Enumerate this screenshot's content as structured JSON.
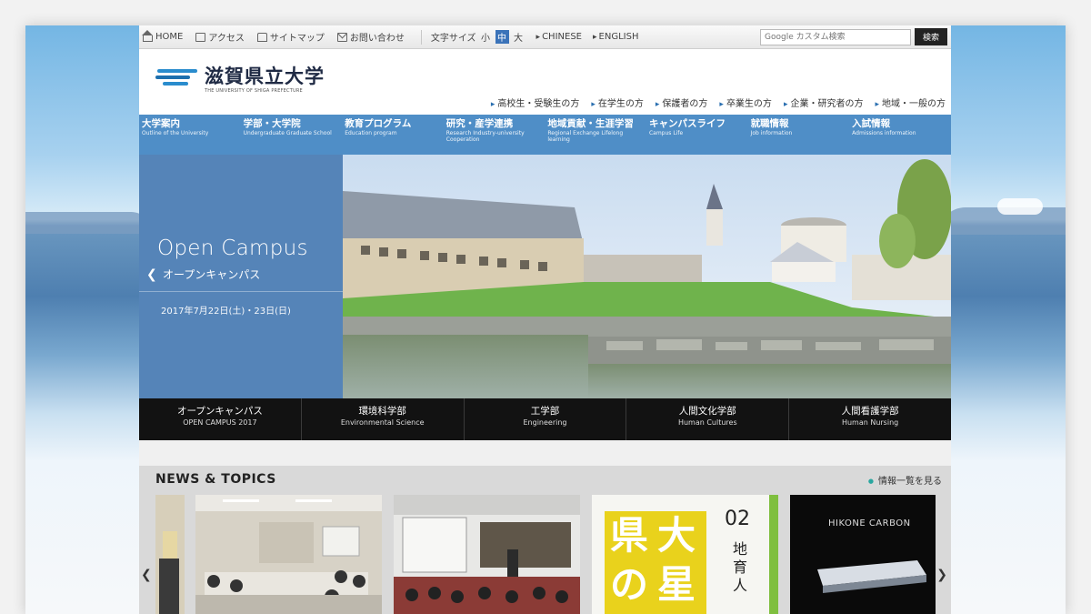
{
  "utility_bar": {
    "links": [
      {
        "label": "HOME",
        "icon": "home-icon"
      },
      {
        "label": "アクセス",
        "icon": "access-icon"
      },
      {
        "label": "サイトマップ",
        "icon": "sitemap-icon"
      },
      {
        "label": "お問い合わせ",
        "icon": "mail-icon"
      }
    ],
    "font_size_label": "文字サイズ",
    "font_sizes": [
      "小",
      "中",
      "大"
    ],
    "font_size_selected": "中",
    "languages": [
      "CHINESE",
      "ENGLISH"
    ],
    "search_placeholder": "Google カスタム検索",
    "search_button": "検索"
  },
  "header": {
    "logo_ja": "滋賀県立大学",
    "logo_en": "THE UNIVERSITY OF SHIGA PREFECTURE",
    "audience_links": [
      "高校生・受験生の方",
      "在学生の方",
      "保護者の方",
      "卒業生の方",
      "企業・研究者の方",
      "地域・一般の方"
    ]
  },
  "global_nav": [
    {
      "ja": "大学案内",
      "en": "Outline of the University"
    },
    {
      "ja": "学部・大学院",
      "en": "Undergraduate Graduate School"
    },
    {
      "ja": "教育プログラム",
      "en": "Education program"
    },
    {
      "ja": "研究・産学連携",
      "en": "Research Industry-university Cooperation"
    },
    {
      "ja": "地域貢献・生涯学習",
      "en": "Regional Exchange Lifelong learning"
    },
    {
      "ja": "キャンパスライフ",
      "en": "Campus Life"
    },
    {
      "ja": "就職情報",
      "en": "Job information"
    },
    {
      "ja": "入試情報",
      "en": "Admissions information"
    }
  ],
  "hero": {
    "title_en": "Open Campus",
    "title_ja": "オープンキャンパス",
    "date": "2017年7月22日(土)・23日(日)"
  },
  "departments": [
    {
      "ja": "オープンキャンパス",
      "en": "OPEN CAMPUS 2017"
    },
    {
      "ja": "環境科学部",
      "en": "Environmental Science"
    },
    {
      "ja": "工学部",
      "en": "Engineering"
    },
    {
      "ja": "人間文化学部",
      "en": "Human Cultures"
    },
    {
      "ja": "人間看護学部",
      "en": "Human Nursing"
    }
  ],
  "news": {
    "title": "NEWS & TOPICS",
    "more_label": "情報一覧を見る",
    "cards": [
      {
        "image": "classroom-meeting-photo"
      },
      {
        "image": "lecture-hall-photo"
      },
      {
        "image": "magazine-cover",
        "chars": [
          "県",
          "大",
          "の",
          "星"
        ],
        "issue": "02",
        "vertical_text": "地育人"
      },
      {
        "image": "hikone-carbon-photo",
        "caption": "HIKONE CARBON"
      }
    ]
  },
  "colors": {
    "nav_blue": "#4f8ec7",
    "hero_blue": "#5584b8",
    "dept_bar": "#121212",
    "magazine_yellow": "#e9d21c"
  }
}
